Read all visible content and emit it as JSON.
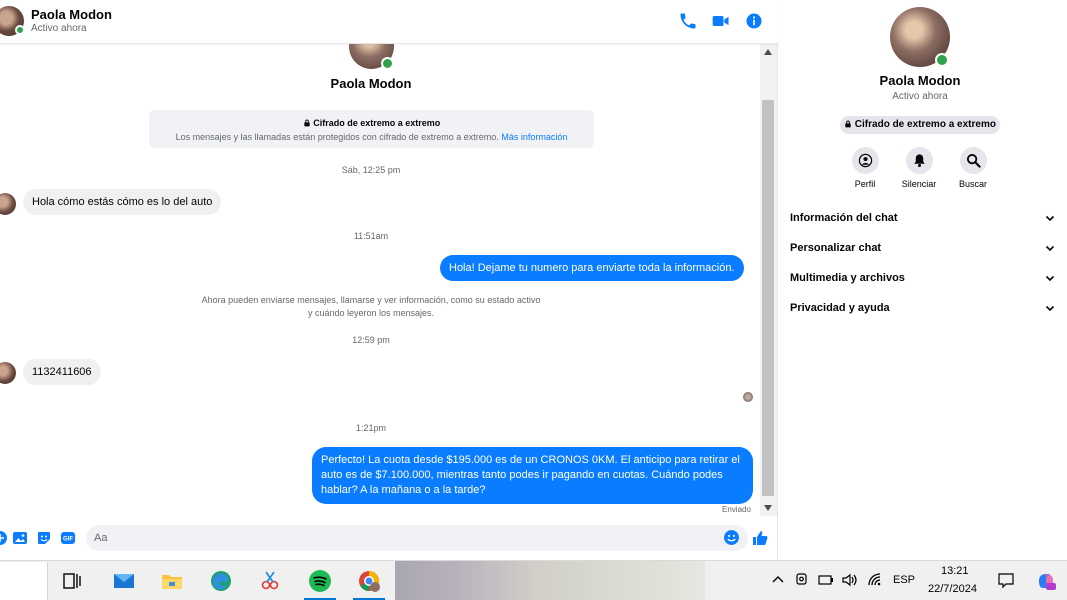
{
  "header": {
    "contact_name": "Paola Modon",
    "status": "Activo ahora",
    "icons": [
      "phone-icon",
      "video-call-icon",
      "info-icon"
    ]
  },
  "intro": {
    "name": "Paola Modon",
    "e2e_title": "Cifrado de extremo a extremo",
    "e2e_desc": "Los mensajes y las llamadas están protegidos con cifrado de extremo a extremo.",
    "e2e_link": "Más información"
  },
  "messages": {
    "ts1": "Sáb, 12:25 pm",
    "msg1": "Hola cómo estás cómo es lo del auto",
    "ts2": "11:51am",
    "msg2": "Hola! Dejame tu numero  para enviarte toda la información.",
    "system_note": "Ahora pueden enviarse mensajes, llamarse y ver información, como su estado activo y cuándo leyeron los mensajes.",
    "ts3": "12:59 pm",
    "msg3": "1132411606",
    "ts4": "1:21pm",
    "msg4": "Perfecto! La cuota desde $195.000 es de un CRONOS 0KM. El anticipo para retirar el auto es de $7.100.000, mientras tanto podes ir pagando en cuotas. Cuándo podes hablar? A la mañana o a la tarde?",
    "sent_label": "Enviado"
  },
  "composer": {
    "placeholder": "Aa",
    "icons": [
      "add-icon",
      "gallery-icon",
      "sticker-icon",
      "gif-icon",
      "emoji-icon",
      "like-icon"
    ],
    "gif_label": "GIF"
  },
  "panel": {
    "name": "Paola Modon",
    "status": "Activo ahora",
    "e2e": "Cifrado de extremo a extremo",
    "actions": [
      {
        "label": "Perfil",
        "icon": "profile-icon"
      },
      {
        "label": "Silenciar",
        "icon": "bell-icon"
      },
      {
        "label": "Buscar",
        "icon": "search-icon"
      }
    ],
    "sections": [
      "Información del chat",
      "Personalizar chat",
      "Multimedia y archivos",
      "Privacidad y ayuda"
    ]
  },
  "taskbar": {
    "apps": [
      "task-view-icon",
      "mail-icon",
      "file-explorer-icon",
      "edge-icon",
      "snipping-tool-icon",
      "spotify-icon",
      "chrome-icon"
    ],
    "language": "ESP",
    "time": "13:21",
    "date": "22/7/2024"
  },
  "colors": {
    "accent": "#0a7cff",
    "online": "#31a24c",
    "bubble_in": "#f0f0f0"
  }
}
